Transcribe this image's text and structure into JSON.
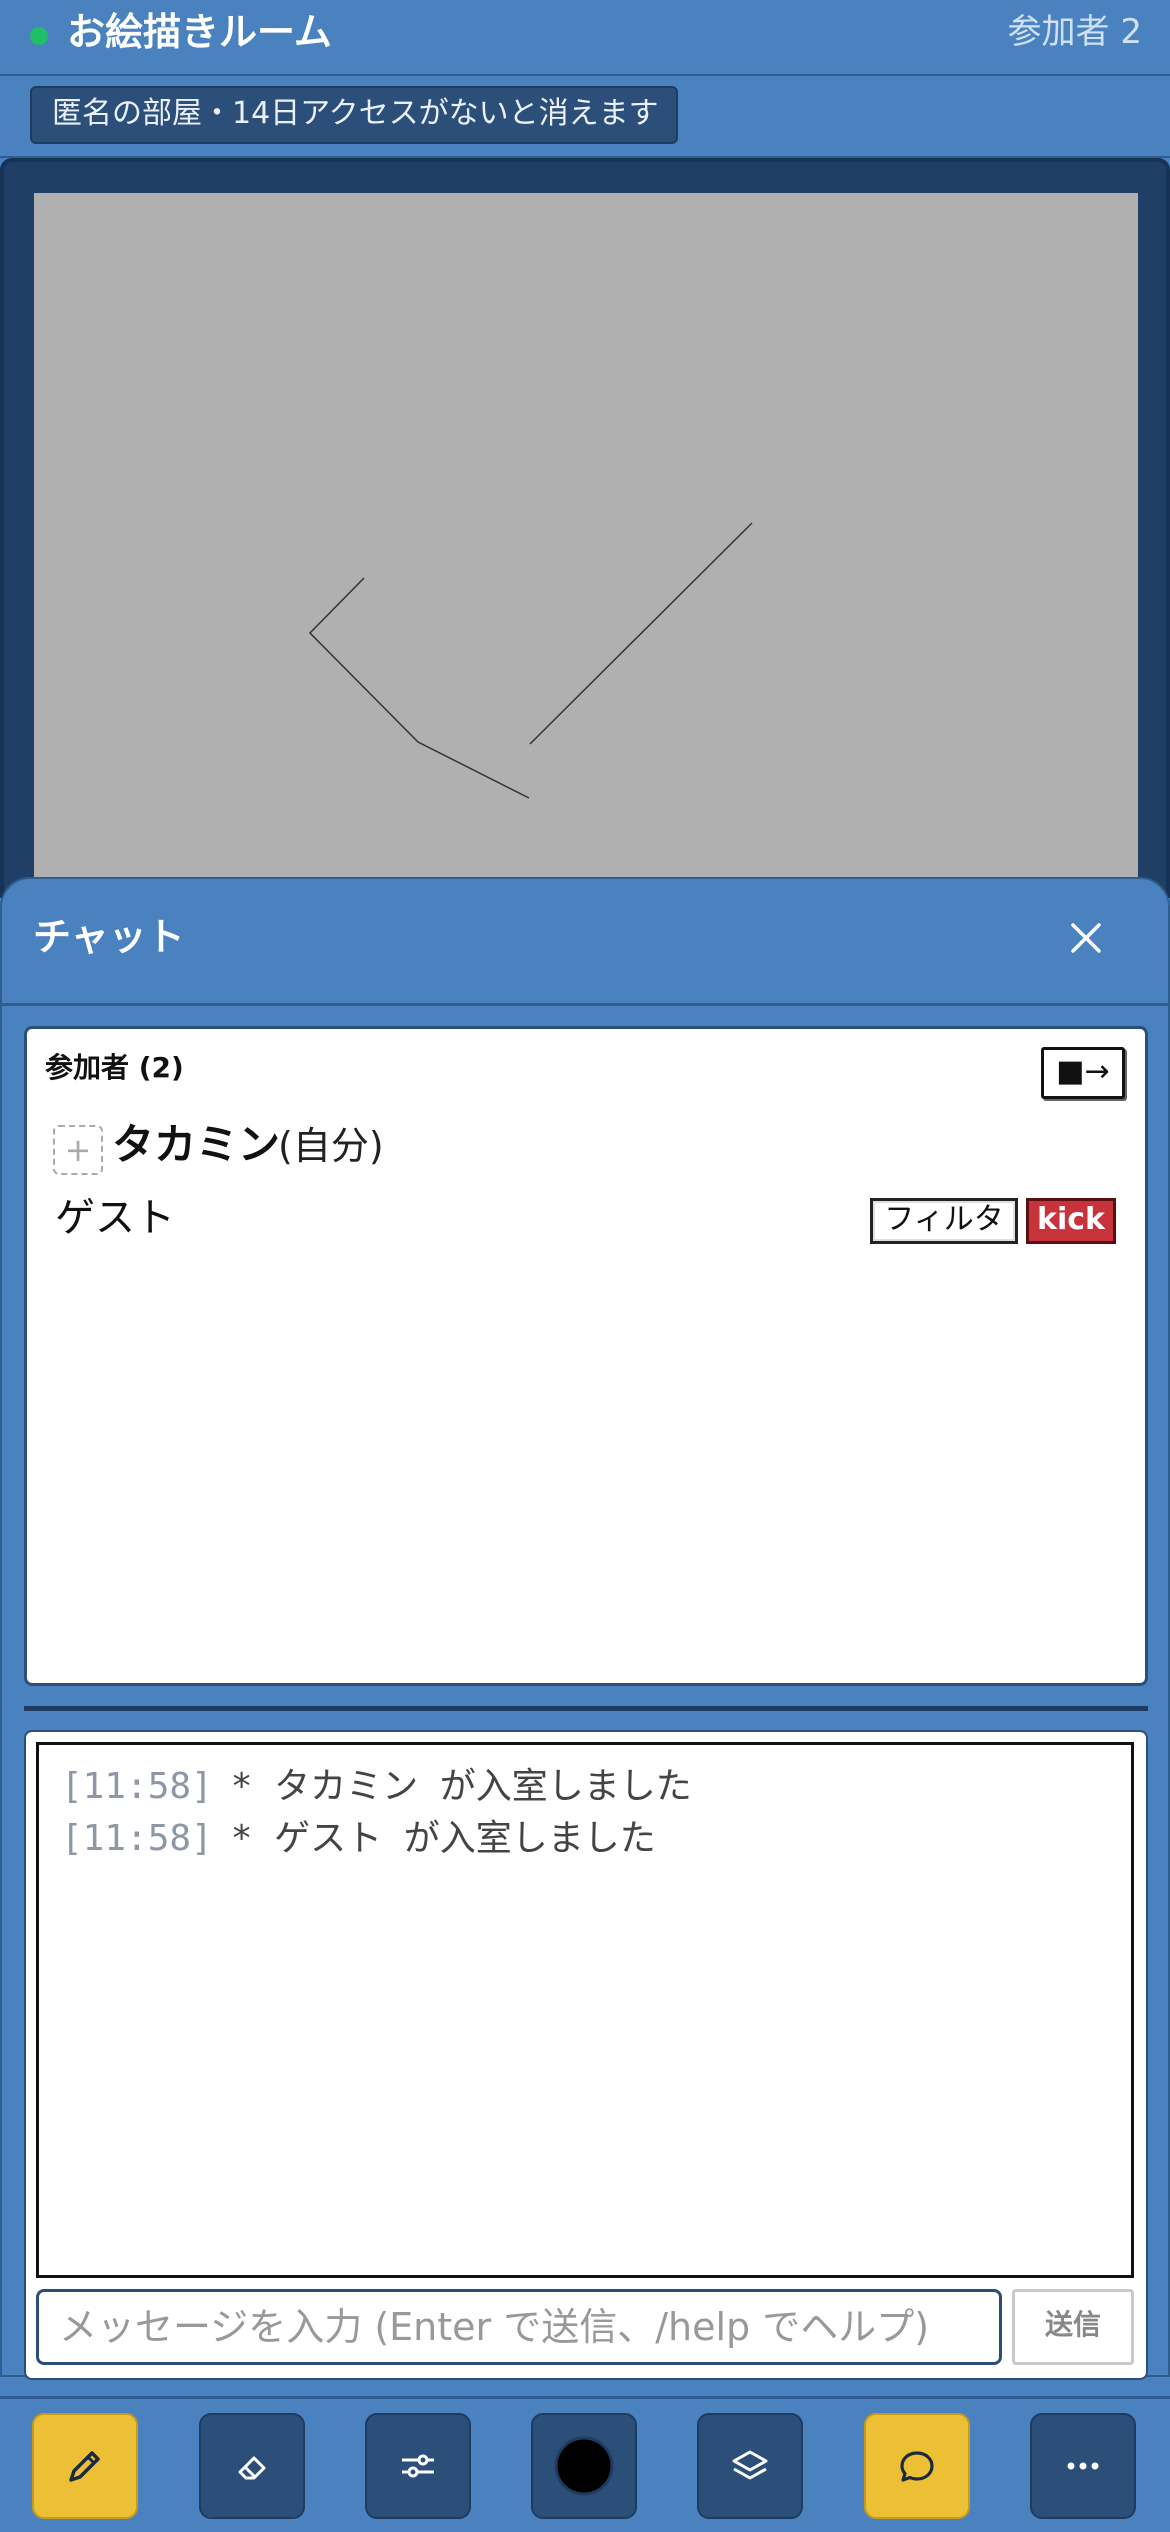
{
  "header": {
    "title": "お絵描きルーム",
    "participants_label": "参加者 2"
  },
  "notice": {
    "text": "匿名の部屋・14日アクセスがないと消えます"
  },
  "chat": {
    "title": "チャット",
    "close_icon": "close-icon",
    "participants": {
      "heading": "参加者 (2)",
      "toggle_label": "■→",
      "self": {
        "name": "タカミン",
        "tag": "(自分)"
      },
      "members": [
        {
          "name": "ゲスト",
          "filter_label": "フィルタ",
          "kick_label": "kick"
        }
      ]
    },
    "log": [
      {
        "time": "[11:58]",
        "text": "* タカミン が入室しました"
      },
      {
        "time": "[11:58]",
        "text": "* ゲスト が入室しました"
      }
    ],
    "input": {
      "placeholder": "メッセージを入力 (Enter で送信、/help でヘルプ)",
      "value": ""
    },
    "send_label": "送信"
  },
  "toolbar": {
    "tools": [
      {
        "name": "pen-icon",
        "active": true
      },
      {
        "name": "eraser-icon",
        "active": false
      },
      {
        "name": "sliders-icon",
        "active": false
      },
      {
        "name": "color-swatch-icon",
        "active": false,
        "color": "#000000"
      },
      {
        "name": "layers-icon",
        "active": false
      },
      {
        "name": "chat-bubble-icon",
        "active": true
      },
      {
        "name": "more-icon",
        "active": false
      }
    ]
  },
  "colors": {
    "header_bg": "#4a82bf",
    "online_dot": "#1fbf6a",
    "canvas_bg": "#b0b0b0",
    "active_tool": "#ecbf34",
    "kick": "#c8323a"
  }
}
